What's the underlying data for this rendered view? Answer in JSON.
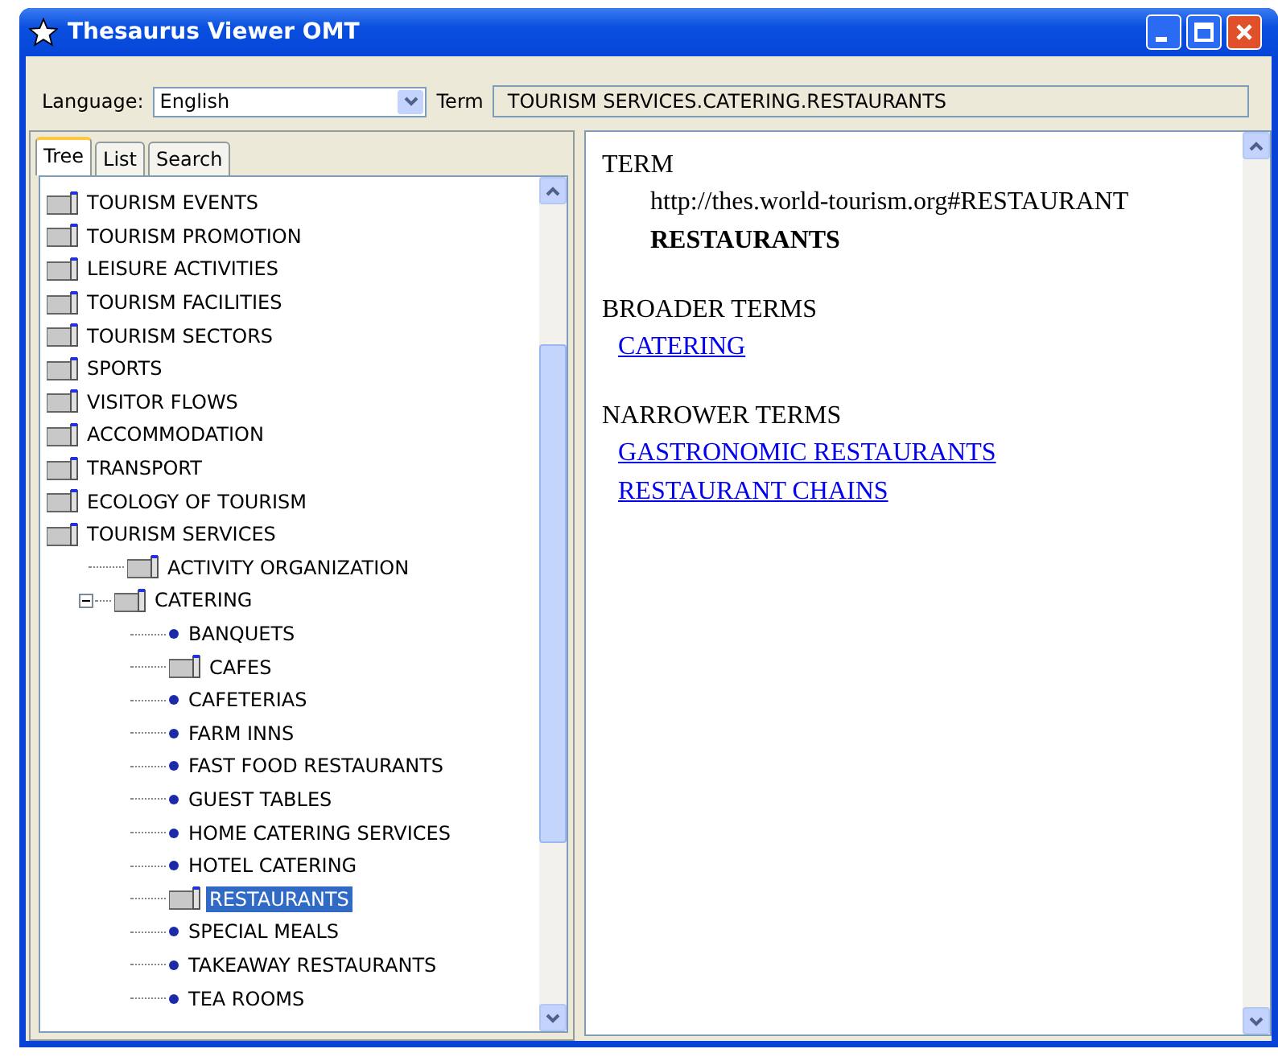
{
  "window": {
    "title": "Thesaurus Viewer OMT"
  },
  "toolbar": {
    "language_label": "Language:",
    "language": "English",
    "term_label": "Term",
    "term": "TOURISM SERVICES.CATERING.RESTAURANTS"
  },
  "tabs": [
    {
      "label": "Tree",
      "selected": true
    },
    {
      "label": "List",
      "selected": false
    },
    {
      "label": "Search",
      "selected": false
    }
  ],
  "tree": [
    {
      "label": "TOURISM EVENTS",
      "kind": "folder",
      "selected": false
    },
    {
      "label": "TOURISM PROMOTION",
      "kind": "folder",
      "selected": false
    },
    {
      "label": "LEISURE ACTIVITIES",
      "kind": "folder",
      "selected": false
    },
    {
      "label": "TOURISM FACILITIES",
      "kind": "folder",
      "selected": false
    },
    {
      "label": "TOURISM SECTORS",
      "kind": "folder",
      "selected": false
    },
    {
      "label": "SPORTS",
      "kind": "folder",
      "selected": false
    },
    {
      "label": "VISITOR FLOWS",
      "kind": "folder",
      "selected": false
    },
    {
      "label": "ACCOMMODATION",
      "kind": "folder",
      "selected": false
    },
    {
      "label": "TRANSPORT",
      "kind": "folder",
      "selected": false
    },
    {
      "label": "ECOLOGY OF TOURISM",
      "kind": "folder",
      "selected": false
    },
    {
      "label": "TOURISM SERVICES",
      "kind": "folder",
      "selected": false,
      "children": [
        {
          "label": "ACTIVITY ORGANIZATION",
          "kind": "folder",
          "selected": false
        },
        {
          "label": "CATERING",
          "kind": "folder",
          "selected": false,
          "expanded": true,
          "children": [
            {
              "label": "BANQUETS",
              "kind": "leaf",
              "selected": false
            },
            {
              "label": "CAFES",
              "kind": "folder",
              "selected": false
            },
            {
              "label": "CAFETERIAS",
              "kind": "leaf",
              "selected": false
            },
            {
              "label": "FARM INNS",
              "kind": "leaf",
              "selected": false
            },
            {
              "label": "FAST FOOD RESTAURANTS",
              "kind": "leaf",
              "selected": false
            },
            {
              "label": "GUEST TABLES",
              "kind": "leaf",
              "selected": false
            },
            {
              "label": "HOME CATERING SERVICES",
              "kind": "leaf",
              "selected": false
            },
            {
              "label": "HOTEL CATERING",
              "kind": "leaf",
              "selected": false
            },
            {
              "label": "RESTAURANTS",
              "kind": "folder",
              "selected": true
            },
            {
              "label": "SPECIAL MEALS",
              "kind": "leaf",
              "selected": false
            },
            {
              "label": "TAKEAWAY RESTAURANTS",
              "kind": "leaf",
              "selected": false
            },
            {
              "label": "TEA ROOMS",
              "kind": "leaf",
              "selected": false
            }
          ]
        }
      ]
    }
  ],
  "detail": {
    "term_heading": "TERM",
    "uri": "http://thes.world-tourism.org#RESTAURANT",
    "term": "RESTAURANTS",
    "broader_heading": "BROADER TERMS",
    "broader": [
      "CATERING"
    ],
    "narrower_heading": "NARROWER TERMS",
    "narrower": [
      "GASTRONOMIC RESTAURANTS",
      "RESTAURANT CHAINS"
    ]
  }
}
